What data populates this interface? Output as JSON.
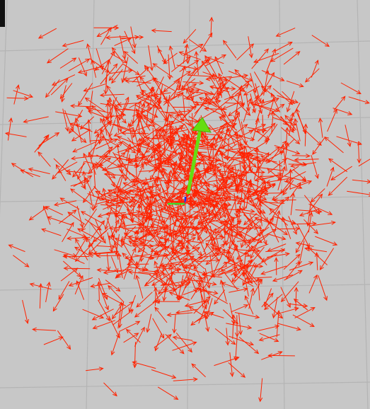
{
  "viewport": {
    "background_color": "#c8c8c8",
    "grid_color": "#b4b4b4"
  },
  "particle_cloud": {
    "arrow_color": "#ff2200",
    "arrow_count": 1400
  },
  "pose_estimate": {
    "arrow_color": "#66dd11",
    "axis_x_color": "#3ddc2a",
    "axis_y_color": "#1030ff",
    "axis_z_color": "#ff3020"
  }
}
